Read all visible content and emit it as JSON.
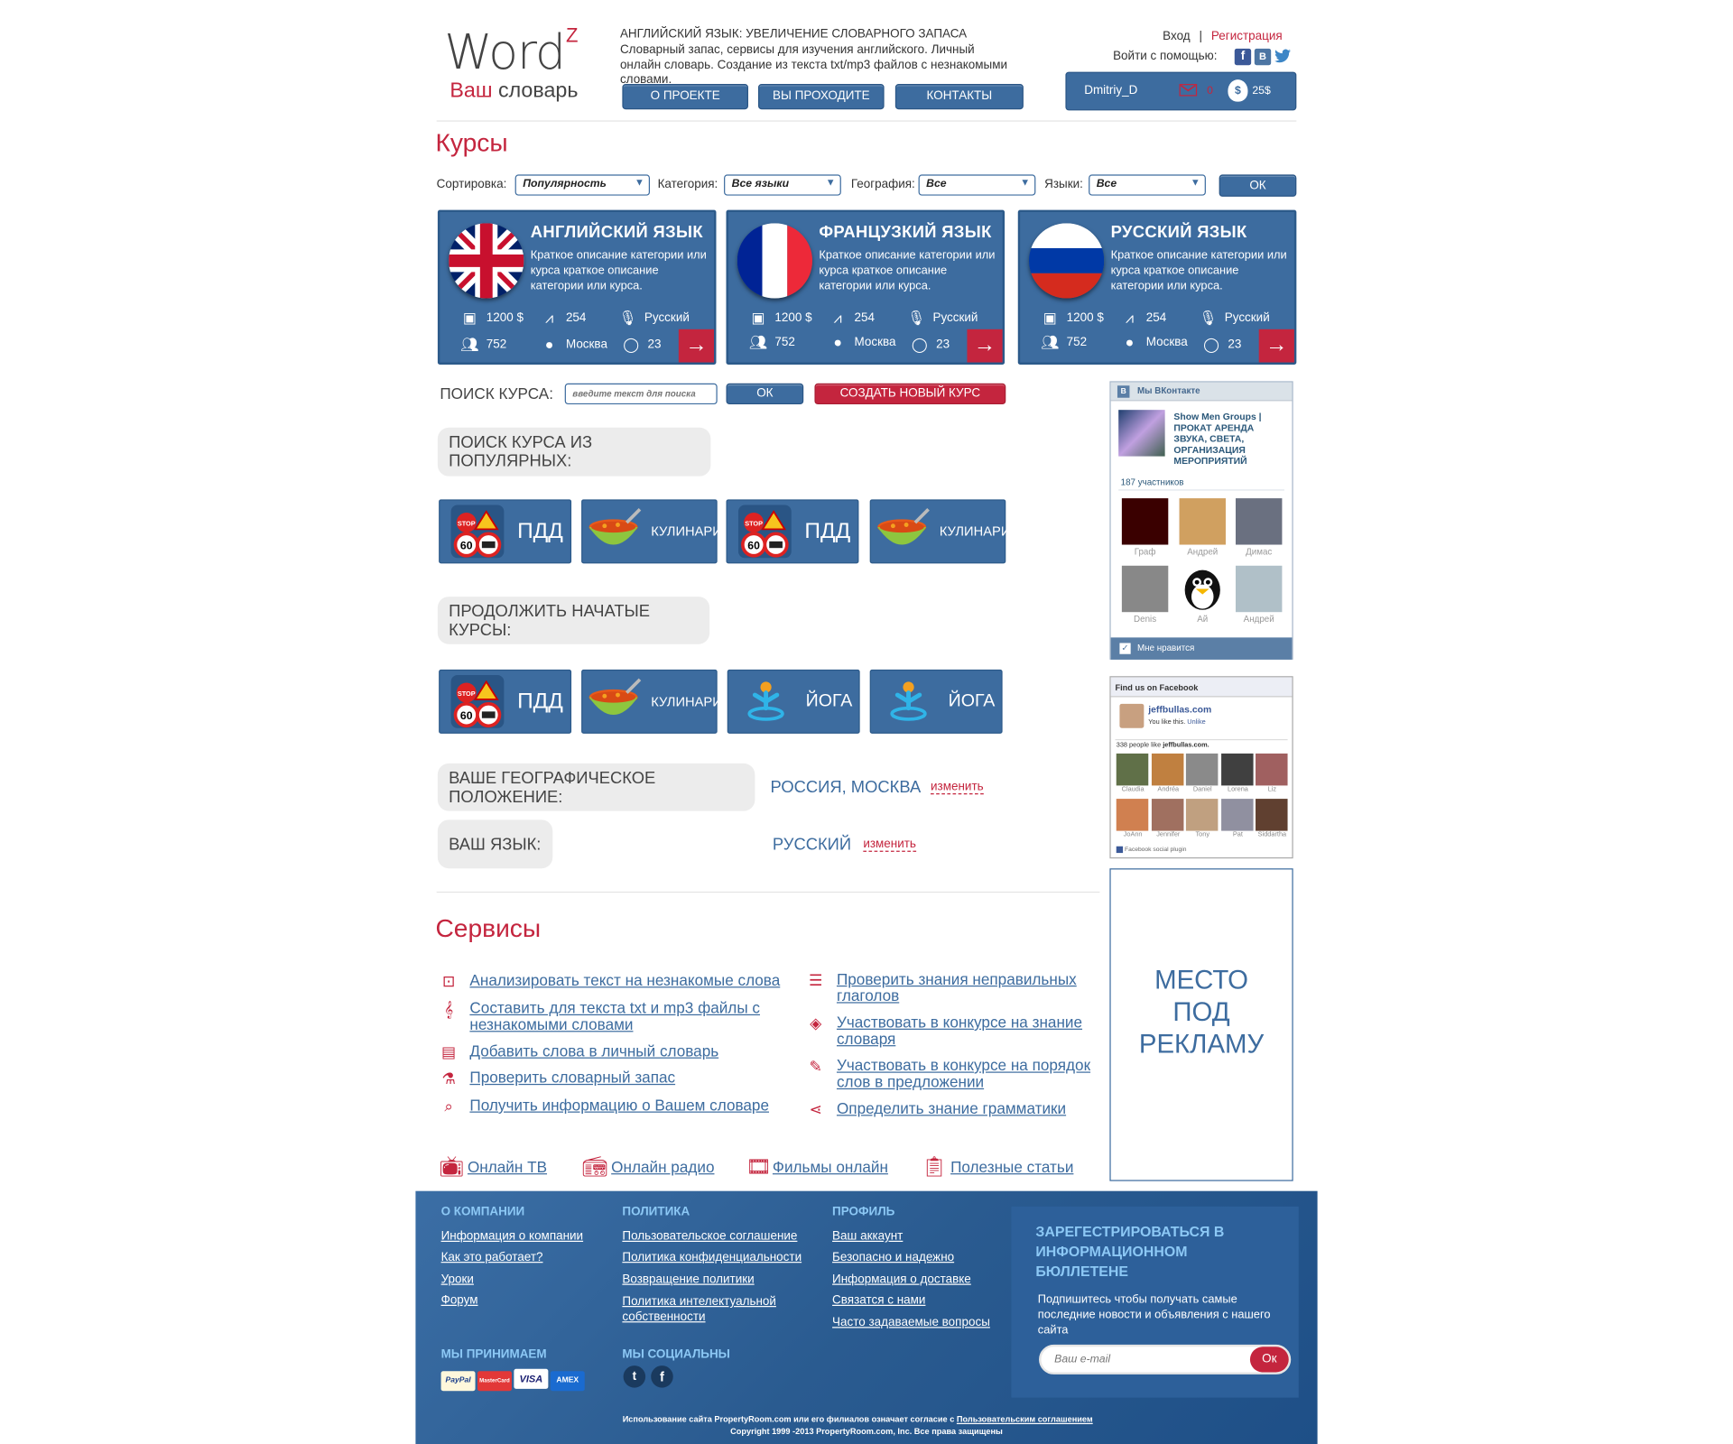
{
  "header": {
    "logo_word": "Word",
    "logo_sup": "Z",
    "logo_your": "Ваш",
    "logo_dict": "словарь",
    "tagline_title": "АНГЛИЙСКИЙ ЯЗЫК: УВЕЛИЧЕНИЕ СЛОВАРНОГО ЗАПАСА",
    "tagline_text": "Словарный запас, сервисы для изучения английского. Личный онлайн словарь. Создание из текста txt/mp3 файлов с незнакомыми словами.",
    "nav": [
      "О ПРОЕКТЕ",
      "ВЫ ПРОХОДИТЕ",
      "КОНТАКТЫ"
    ],
    "login": "Вход",
    "sep": "|",
    "register": "Регистрация",
    "login_with": "Войти с помощью:",
    "user": "Dmitriy_D",
    "messages": "0",
    "balance": "25$"
  },
  "courses": {
    "title": "Курсы",
    "sort_label": "Сортировка:",
    "sort_value": "Популярность",
    "category_label": "Категория:",
    "category_value": "Все языки",
    "geo_label": "География:",
    "geo_value": "Все",
    "lang_label": "Языки:",
    "lang_value": "Все",
    "ok": "ОК",
    "cards": [
      {
        "title": "АНГЛИЙСКИЙ ЯЗЫК",
        "desc": "Краткое описание категории или курса краткое описание категории или курса.",
        "price": "1200 $",
        "stat": "254",
        "lang": "Русский",
        "users": "752",
        "city": "Москва",
        "comments": "23"
      },
      {
        "title": "ФРАНЦУЗКИЙ ЯЗЫК",
        "desc": "Краткое описание категории или курса краткое описание категории или курса.",
        "price": "1200 $",
        "stat": "254",
        "lang": "Русский",
        "users": "752",
        "city": "Москва",
        "comments": "23"
      },
      {
        "title": "РУССКИЙ ЯЗЫК",
        "desc": "Краткое описание категории или курса краткое описание категории или курса.",
        "price": "1200 $",
        "stat": "254",
        "lang": "Русский",
        "users": "752",
        "city": "Москва",
        "comments": "23"
      }
    ]
  },
  "search": {
    "label": "ПОИСК КУРСА:",
    "placeholder": "введите текст для поиска",
    "ok": "ОК",
    "create": "СОЗДАТЬ НОВЫЙ КУРС"
  },
  "popular": {
    "label": "ПОИСК КУРСА ИЗ ПОПУЛЯРНЫХ:",
    "tiles": [
      "ПДД",
      "КУЛИНАРИЯ",
      "ПДД",
      "КУЛИНАРИЯ"
    ]
  },
  "continue": {
    "label": "ПРОДОЛЖИТЬ НАЧАТЫЕ КУРСЫ:",
    "tiles": [
      "ПДД",
      "КУЛИНАРИЯ",
      "ЙОГА",
      "ЙОГА"
    ]
  },
  "geo": {
    "label": "ВАШЕ ГЕОГРАФИЧЕСКОЕ ПОЛОЖЕНИЕ:",
    "value": "РОССИЯ, МОСКВА",
    "change": "изменить"
  },
  "language": {
    "label": "ВАШ ЯЗЫК:",
    "value": "РУССКИЙ",
    "change": "изменить"
  },
  "services": {
    "title": "Сервисы",
    "left": [
      "Анализировать текст на незнакомые слова",
      "Составить для текста txt и mp3 файлы с незнакомыми словами",
      "Добавить слова в личный словарь",
      "Проверить словарный запас",
      "Получить информацию о Вашем словаре"
    ],
    "right": [
      "Проверить знания неправильных глаголов",
      "Участвовать в конкурсе на знание словаря",
      "Участвовать в конкурсе на порядок слов в предложении",
      "Определить знание грамматики"
    ],
    "media": [
      "Онлайн ТВ",
      "Онлайн радио",
      "Фильмы онлайн",
      "Полезные статьи"
    ]
  },
  "vk": {
    "header": "Мы ВКонтакте",
    "group": "Show Men Groups | ПРОКАТ АРЕНДА ЗВУКА, СВЕТА, ОРГАНИЗАЦИЯ МЕРОПРИЯТИЙ",
    "members": "187 участников",
    "names": [
      "Граф",
      "Андрей",
      "Димас",
      "Denis",
      "Ай",
      "Андрей"
    ],
    "like": "Мне нравится"
  },
  "fb": {
    "header": "Find us on Facebook",
    "page": "jeffbullas.com",
    "you_like": "You like this.",
    "unlike": "Unlike",
    "count": "338 people like",
    "count_page": "jeffbullas.com.",
    "names": [
      "Claudia",
      "Andréa",
      "Daniel",
      "Lorena",
      "Liz",
      "JoAnn",
      "Jennifer",
      "Tony",
      "Pat",
      "Siddartha"
    ],
    "plugin": "Facebook social plugin"
  },
  "ad": {
    "l1": "МЕСТО",
    "l2": "ПОД",
    "l3": "РЕКЛАМУ"
  },
  "footer": {
    "col1_title": "О КОМПАНИИ",
    "col1": [
      "Информация о компании",
      "Как это работает?",
      "Уроки",
      "Форум"
    ],
    "col2_title": "ПОЛИТИКА",
    "col2": [
      "Пользовательское соглашение",
      "Политика конфиденциальности",
      "Возвращение политики",
      "Политика интелектуальной собственности"
    ],
    "col3_title": "ПРОФИЛЬ",
    "col3": [
      "Ваш аккаунт",
      "Безопасно и надежно",
      "Информация о доставке",
      "Связатся с нами",
      "Часто задаваемые вопросы"
    ],
    "accept_title": "МЫ ПРИНИМАЕМ",
    "pay": [
      "PayPal",
      "MasterCard",
      "VISA",
      "AMEX"
    ],
    "social_title": "МЫ СОЦИАЛЬНЫ",
    "news_title": "ЗАРЕГЕСТРИРОВАТЬСЯ В ИНФОРМАЦИОННОМ БЮЛЛЕТЕНЕ",
    "news_text": "Подпишитесь чтобы получать самые последние новости и объявления с нашего сайта",
    "email_placeholder": "Ваш e-mail",
    "news_ok": "Ок",
    "legal1": "Использование сайта PropertyRoom.com или его филиалов означает согласие с",
    "legal1_link": "Пользовательским соглашением",
    "legal2": "Copyright 1999 -2013 PropertyRoom.com, Inc. Все права защищены"
  },
  "colors": {
    "primary": "#3d6c9f",
    "accent": "#c4253e",
    "footer_bg": "#2d5d93",
    "light_gray": "#ececec"
  }
}
